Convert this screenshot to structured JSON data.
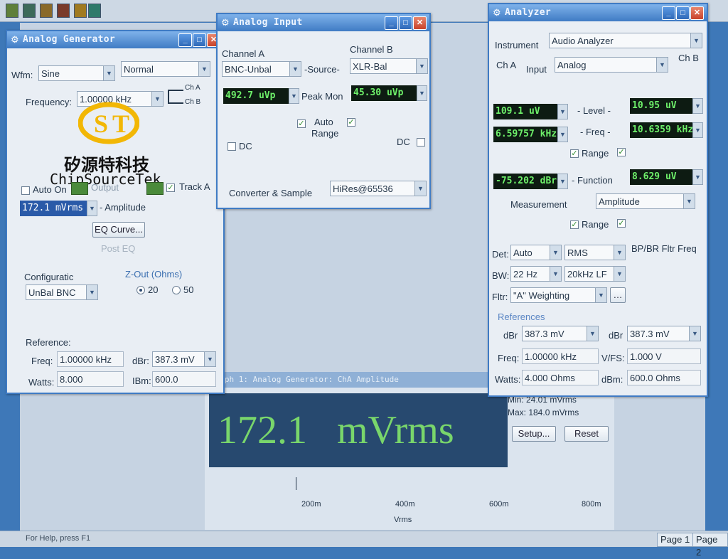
{
  "colors": {
    "title_bar": "#3f7bc4",
    "lcd_bg": "#0d1b12",
    "lcd_text": "#6ef06a",
    "readout_bg": "#27496f",
    "readout_text": "#79d66b",
    "desktop": "#3e78b8"
  },
  "logo": {
    "cn": "矽源特科技",
    "en": "ChipSourceTek"
  },
  "gen": {
    "title": "Analog Generator",
    "wfm_label": "Wfm:",
    "wfm_value": "Sine",
    "mode_value": "Normal",
    "freq_label": "Frequency:",
    "freq_value": "1.00000 kHz",
    "cha": "Ch A",
    "chb": "Ch B",
    "autoon": "Auto On",
    "output": "Output",
    "tracka": "Track A",
    "amp_value": "172.1  mVrms",
    "amp_label": "- Amplitude",
    "eq_button": "EQ Curve...",
    "posteq": "Post EQ",
    "config_label": "Configuratic",
    "config_value": "UnBal BNC",
    "zout_label": "Z-Out (Ohms)",
    "z20": "20",
    "z50": "50",
    "ref_label": "Reference:",
    "freq_ref_label": "Freq:",
    "freq_ref_value": "1.00000 kHz",
    "dbr_label": "dBr:",
    "dbr_value": "387.3   mV",
    "watts_label": "Watts:",
    "watts_value": "8.000",
    "dbm_label": "IBm:",
    "dbm_value": "600.0"
  },
  "input": {
    "title": "Analog Input",
    "cha": "Channel A",
    "chb": "Channel B",
    "srca": "BNC-Unbal",
    "source_label": "-Source-",
    "srcb": "XLR-Bal",
    "peaka": "492.7  uVp",
    "peakmon": "Peak Mon",
    "peakb": "45.30  uVp",
    "auto": "Auto",
    "range": "Range",
    "dc": "DC",
    "conv_label": "Converter & Sample",
    "conv_value": "HiRes@65536"
  },
  "analyzer": {
    "title": "Analyzer",
    "instr_label": "Instrument",
    "instr_value": "Audio Analyzer",
    "cha": "Ch A",
    "input_label": "Input",
    "input_value": "Analog",
    "chb": "Ch B",
    "level_a": "109.1  uV",
    "level_label": "- Level -",
    "level_b": "10.95  uV",
    "freq_a": "6.59757 kHz",
    "freq_label": "- Freq -",
    "freq_b": "10.6359 kHz",
    "range": "Range",
    "func_a": "-75.202 dBr",
    "func_label": "- Function",
    "func_b": "8.629  uV",
    "meas_label": "Measurement",
    "meas_value": "Amplitude",
    "det_label": "Det:",
    "det_value": "Auto",
    "det2_value": "RMS",
    "bw_label": "BW:",
    "bw_value": "22 Hz",
    "bw2_value": "20kHz LF",
    "fltr_label": "Fltr:",
    "fltr_value": "\"A\" Weighting",
    "bfbr": "BP/BR Fltr Freq",
    "refs_label": "References",
    "dbr_l_label": "dBr",
    "dbr_l_value": "387.3    mV",
    "dbr_r_label": "dBr",
    "dbr_r_value": "387.3    mV",
    "freq_label2": "Freq:",
    "freq_value": "1.00000 kHz",
    "vfs_label": "V/FS:",
    "vfs_value": "1.000     V",
    "watts_label": "Watts:",
    "watts_value": "4.000    Ohms",
    "dbm_label": "dBm:",
    "dbm_value": "600.0    Ohms"
  },
  "graph": {
    "title": "Graph 1: Analog Generator: ChA Amplitude",
    "readout": "172.1   mVrms",
    "min_label": "Min: 24.01   mVrms",
    "max_label": "Max: 184.0   mVrms",
    "setup": "Setup...",
    "reset": "Reset",
    "ticks": [
      "200m",
      "400m",
      "600m",
      "800m"
    ],
    "unit": "Vrms"
  },
  "status": {
    "help": "For Help, press F1",
    "page1": "Page 1",
    "page2": "Page 2"
  }
}
